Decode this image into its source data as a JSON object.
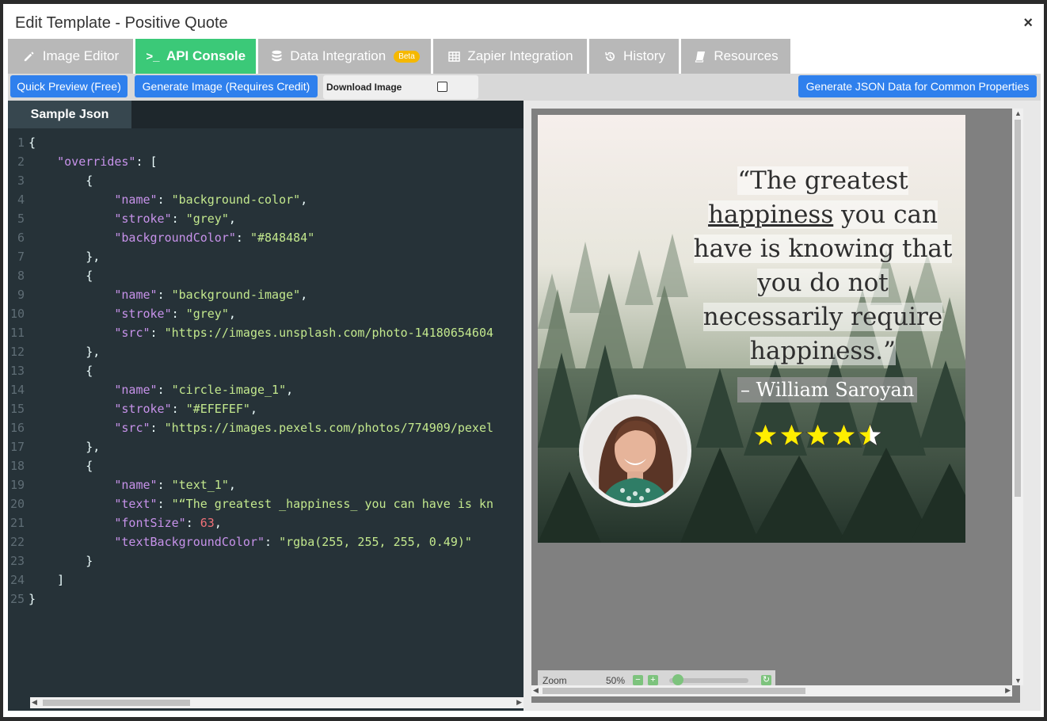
{
  "window": {
    "title": "Edit Template - Positive Quote",
    "close": "×"
  },
  "tabs": [
    {
      "label": "Image Editor",
      "icon": "pencil-icon"
    },
    {
      "label": "API Console",
      "icon": "terminal-icon",
      "prefix": ">_"
    },
    {
      "label": "Data Integration",
      "icon": "database-icon",
      "badge": "Beta"
    },
    {
      "label": "Zapier Integration",
      "icon": "table-icon"
    },
    {
      "label": "History",
      "icon": "history-icon"
    },
    {
      "label": "Resources",
      "icon": "book-icon"
    }
  ],
  "toolbar": {
    "quick_preview": "Quick Preview (Free)",
    "generate_image": "Generate Image (Requires Credit)",
    "download_image": "Download Image",
    "generate_json": "Generate JSON Data for Common Properties"
  },
  "editor": {
    "tab": "Sample Json",
    "lines": [
      "{",
      "    \"overrides\": [",
      "        {",
      "            \"name\": \"background-color\",",
      "            \"stroke\": \"grey\",",
      "            \"backgroundColor\": \"#848484\"",
      "        },",
      "        {",
      "            \"name\": \"background-image\",",
      "            \"stroke\": \"grey\",",
      "            \"src\": \"https://images.unsplash.com/photo-14180654604",
      "        },",
      "        {",
      "            \"name\": \"circle-image_1\",",
      "            \"stroke\": \"#EFEFEF\",",
      "            \"src\": \"https://images.pexels.com/photos/774909/pexel",
      "        },",
      "        {",
      "            \"name\": \"text_1\",",
      "            \"text\": \"“The greatest _happiness_ you can have is kn",
      "            \"fontSize\": 63,",
      "            \"textBackgroundColor\": \"rgba(255, 255, 255, 0.49)\"",
      "        }",
      "    ]",
      "}"
    ]
  },
  "preview": {
    "quote_lines": [
      "“The greatest",
      "happiness you can",
      "have is knowing that",
      "you do not",
      "necessarily require",
      "happiness.”"
    ],
    "quote_parts": {
      "underlined": "happiness",
      "after_underlined": " you can"
    },
    "author": "– William Saroyan",
    "rating": 4.5,
    "zoom_label": "Zoom",
    "zoom_value": "50%"
  }
}
